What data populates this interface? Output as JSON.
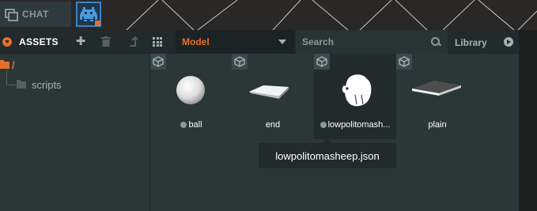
{
  "chat_tab": {
    "label": "CHAT"
  },
  "assets_panel": {
    "title": "ASSETS",
    "toolbar": {
      "add_icon": "plus-icon",
      "delete_icon": "trash-icon",
      "up_icon": "level-up-icon",
      "view_icon": "grid-view-icon"
    },
    "type_filter": {
      "selected": "Model"
    },
    "search": {
      "placeholder": "Search"
    },
    "library_label": "Library",
    "accent_color": "#e86e2c"
  },
  "tree": {
    "root": {
      "label": "/"
    },
    "children": [
      {
        "label": "scripts"
      }
    ]
  },
  "assets": [
    {
      "label": "ball",
      "has_status_dot": true,
      "thumb": "sphere"
    },
    {
      "label": "end",
      "has_status_dot": false,
      "thumb": "slab"
    },
    {
      "label": "lowpolitomash...",
      "has_status_dot": true,
      "thumb": "sheep"
    },
    {
      "label": "plain",
      "has_status_dot": false,
      "thumb": "plane"
    }
  ],
  "tooltip": {
    "text": "lowpolitomasheep.json"
  }
}
